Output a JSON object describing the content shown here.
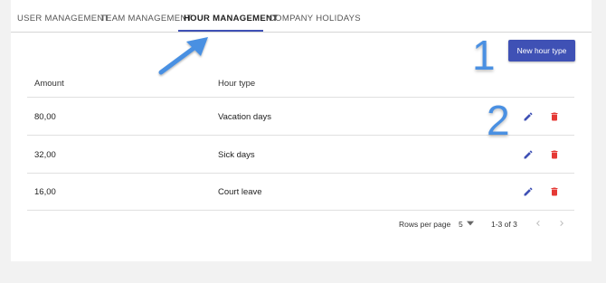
{
  "tabs": [
    {
      "label": "USER MANAGEMENT",
      "active": false
    },
    {
      "label": "TEAM MANAGEMENT",
      "active": false
    },
    {
      "label": "HOUR MANAGEMENT",
      "active": true
    },
    {
      "label": "COMPANY HOLIDAYS",
      "active": false
    }
  ],
  "toolbar": {
    "new_hour_type_label": "New hour type"
  },
  "table": {
    "headers": {
      "amount": "Amount",
      "hour_type": "Hour type"
    },
    "rows": [
      {
        "amount": "80,00",
        "hour_type": "Vacation days"
      },
      {
        "amount": "32,00",
        "hour_type": "Sick days"
      },
      {
        "amount": "16,00",
        "hour_type": "Court leave"
      }
    ]
  },
  "pagination": {
    "rows_per_page_label": "Rows per page",
    "rows_per_page_value": "5",
    "range": "1-3 of 3"
  },
  "annotations": {
    "marker_1": "1",
    "marker_2": "2"
  },
  "colors": {
    "accent": "#3f51b5",
    "delete": "#e53935",
    "annotation": "#4a90e2"
  },
  "icons": {
    "edit": "pencil-icon",
    "delete": "trash-icon",
    "dropdown": "caret-down-icon",
    "prev": "chevron-left-icon",
    "next": "chevron-right-icon"
  }
}
